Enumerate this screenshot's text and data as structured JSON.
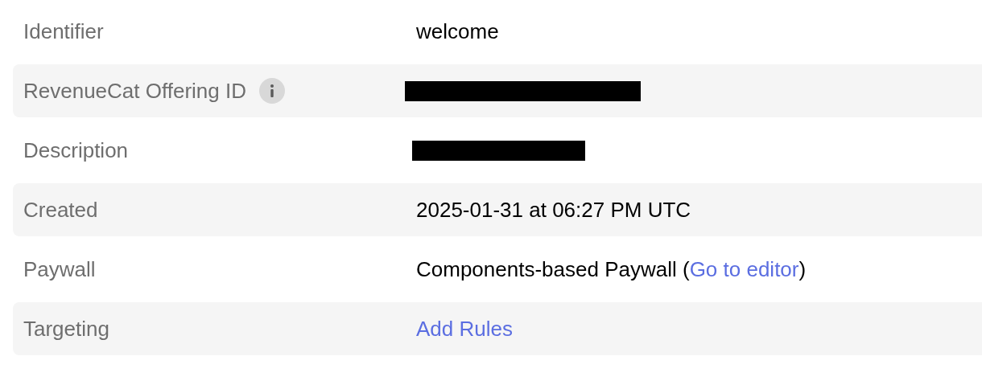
{
  "rows": [
    {
      "label": "Identifier",
      "info": false,
      "value": {
        "kind": "text",
        "text": "welcome"
      }
    },
    {
      "label": "RevenueCat Offering ID",
      "info": true,
      "value": {
        "kind": "redacted"
      }
    },
    {
      "label": "Description",
      "info": false,
      "value": {
        "kind": "redacted"
      }
    },
    {
      "label": "Created",
      "info": false,
      "value": {
        "kind": "text",
        "text": "2025-01-31 at 06:27 PM UTC"
      }
    },
    {
      "label": "Paywall",
      "info": false,
      "value": {
        "kind": "text_link",
        "before": "Components-based Paywall (",
        "link": "Go to editor",
        "after": ")"
      }
    },
    {
      "label": "Targeting",
      "info": false,
      "value": {
        "kind": "link",
        "text": "Add Rules"
      }
    }
  ]
}
